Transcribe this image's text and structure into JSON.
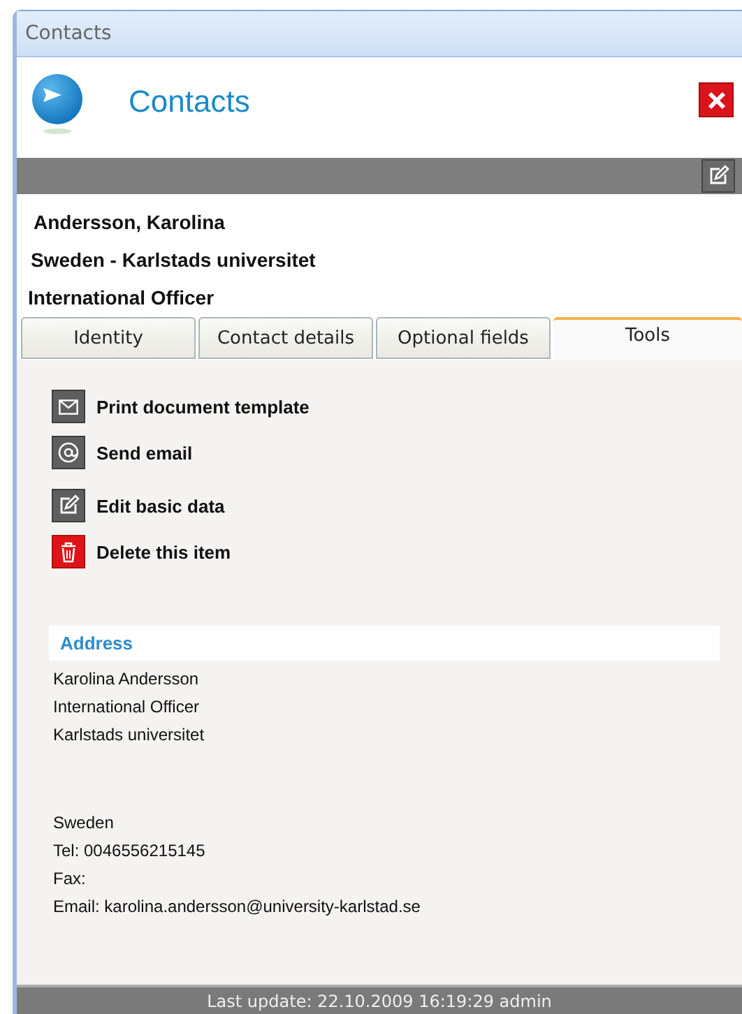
{
  "window": {
    "title": "Contacts"
  },
  "header": {
    "title": "Contacts"
  },
  "contact": {
    "name": "Andersson, Karolina",
    "organisation": "Sweden - Karlstads universitet",
    "role": "International Officer"
  },
  "tabs": [
    {
      "label": "Identity",
      "selected": false
    },
    {
      "label": "Contact details",
      "selected": false
    },
    {
      "label": "Optional fields",
      "selected": false
    },
    {
      "label": "Tools",
      "selected": true
    }
  ],
  "tools": [
    {
      "kind": "mail",
      "label": "Print document template"
    },
    {
      "kind": "at",
      "label": "Send email"
    },
    {
      "kind": "edit",
      "label": "Edit basic data"
    },
    {
      "kind": "delete",
      "label": "Delete this item"
    }
  ],
  "address": {
    "heading": "Address",
    "blocks": [
      [
        "Karolina Andersson",
        "International Officer",
        "Karlstads universitet"
      ],
      [
        "Sweden",
        "Tel: 0046556215145",
        "Fax:",
        "Email: karolina.andersson@university-karlstad.se"
      ]
    ]
  },
  "status_bar": "Last update: 22.10.2009 16:19:29 admin"
}
